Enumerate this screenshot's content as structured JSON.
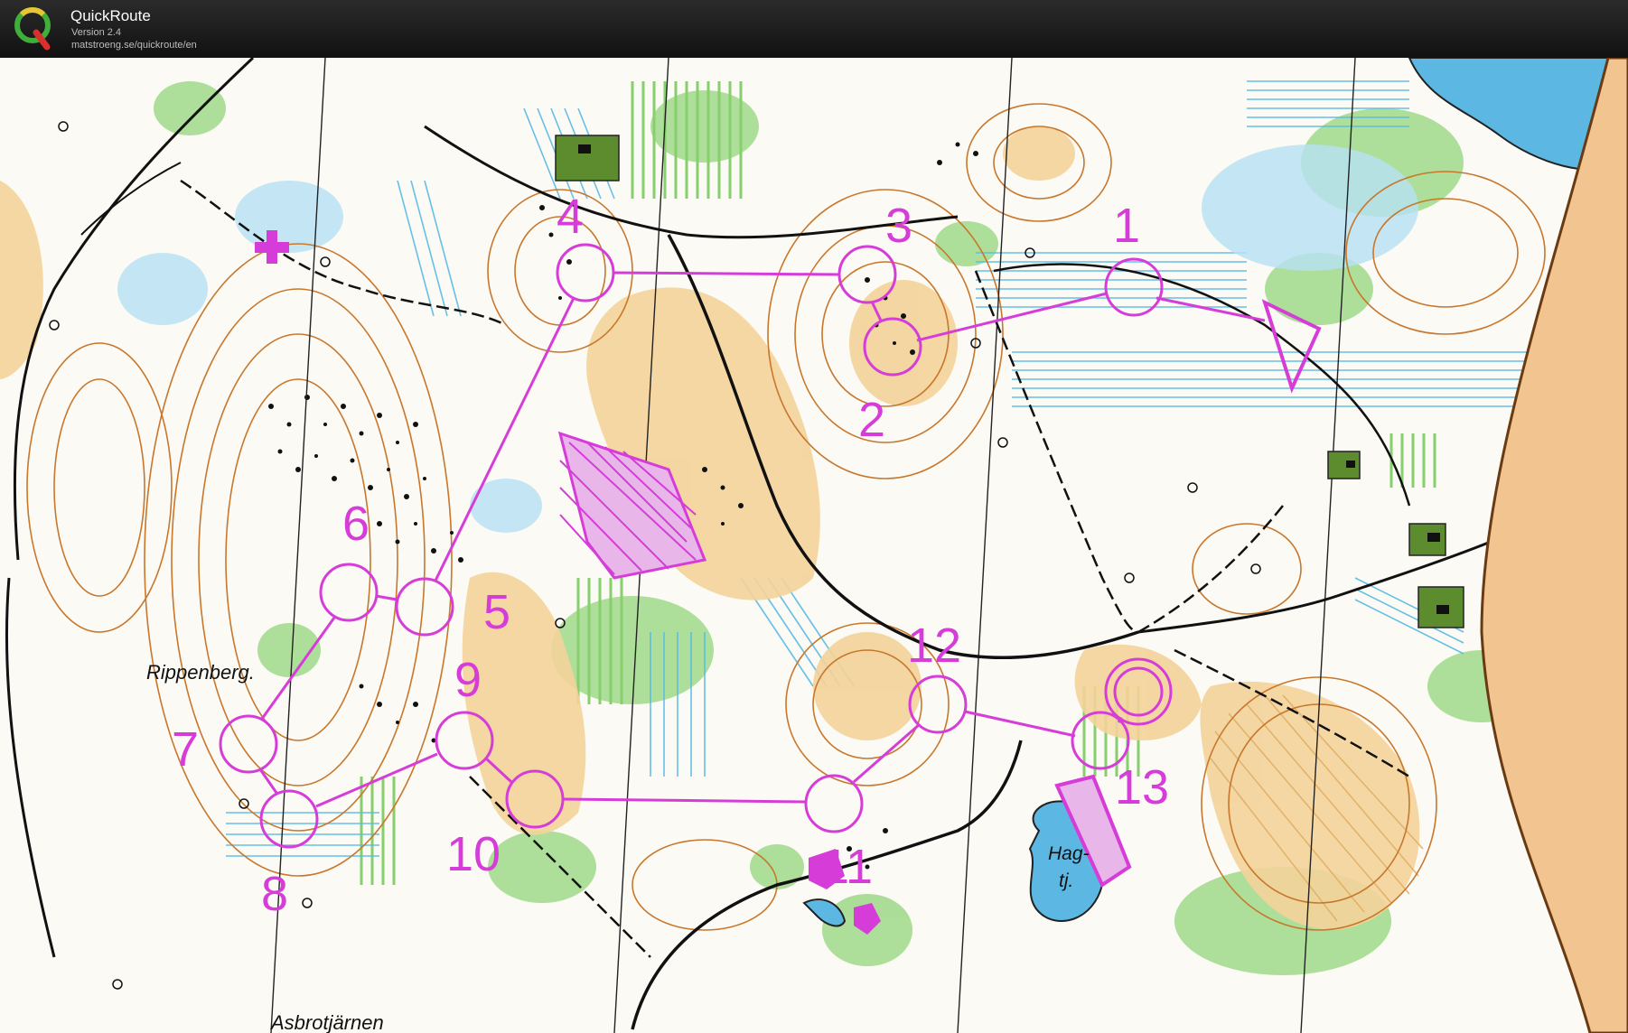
{
  "app": {
    "name": "QuickRoute",
    "version": "Version 2.4",
    "url": "matstroeng.se/quickroute/en"
  },
  "map": {
    "course_color": "#d63dd8",
    "place_names": {
      "rippenberg": "Rippenberg.",
      "hag": "Hag-",
      "tj": "tj.",
      "asbrotjarnen": "Asbrotjärnen"
    },
    "controls": [
      "1",
      "2",
      "3",
      "4",
      "5",
      "6",
      "7",
      "8",
      "9",
      "10",
      "11",
      "12",
      "13"
    ]
  }
}
